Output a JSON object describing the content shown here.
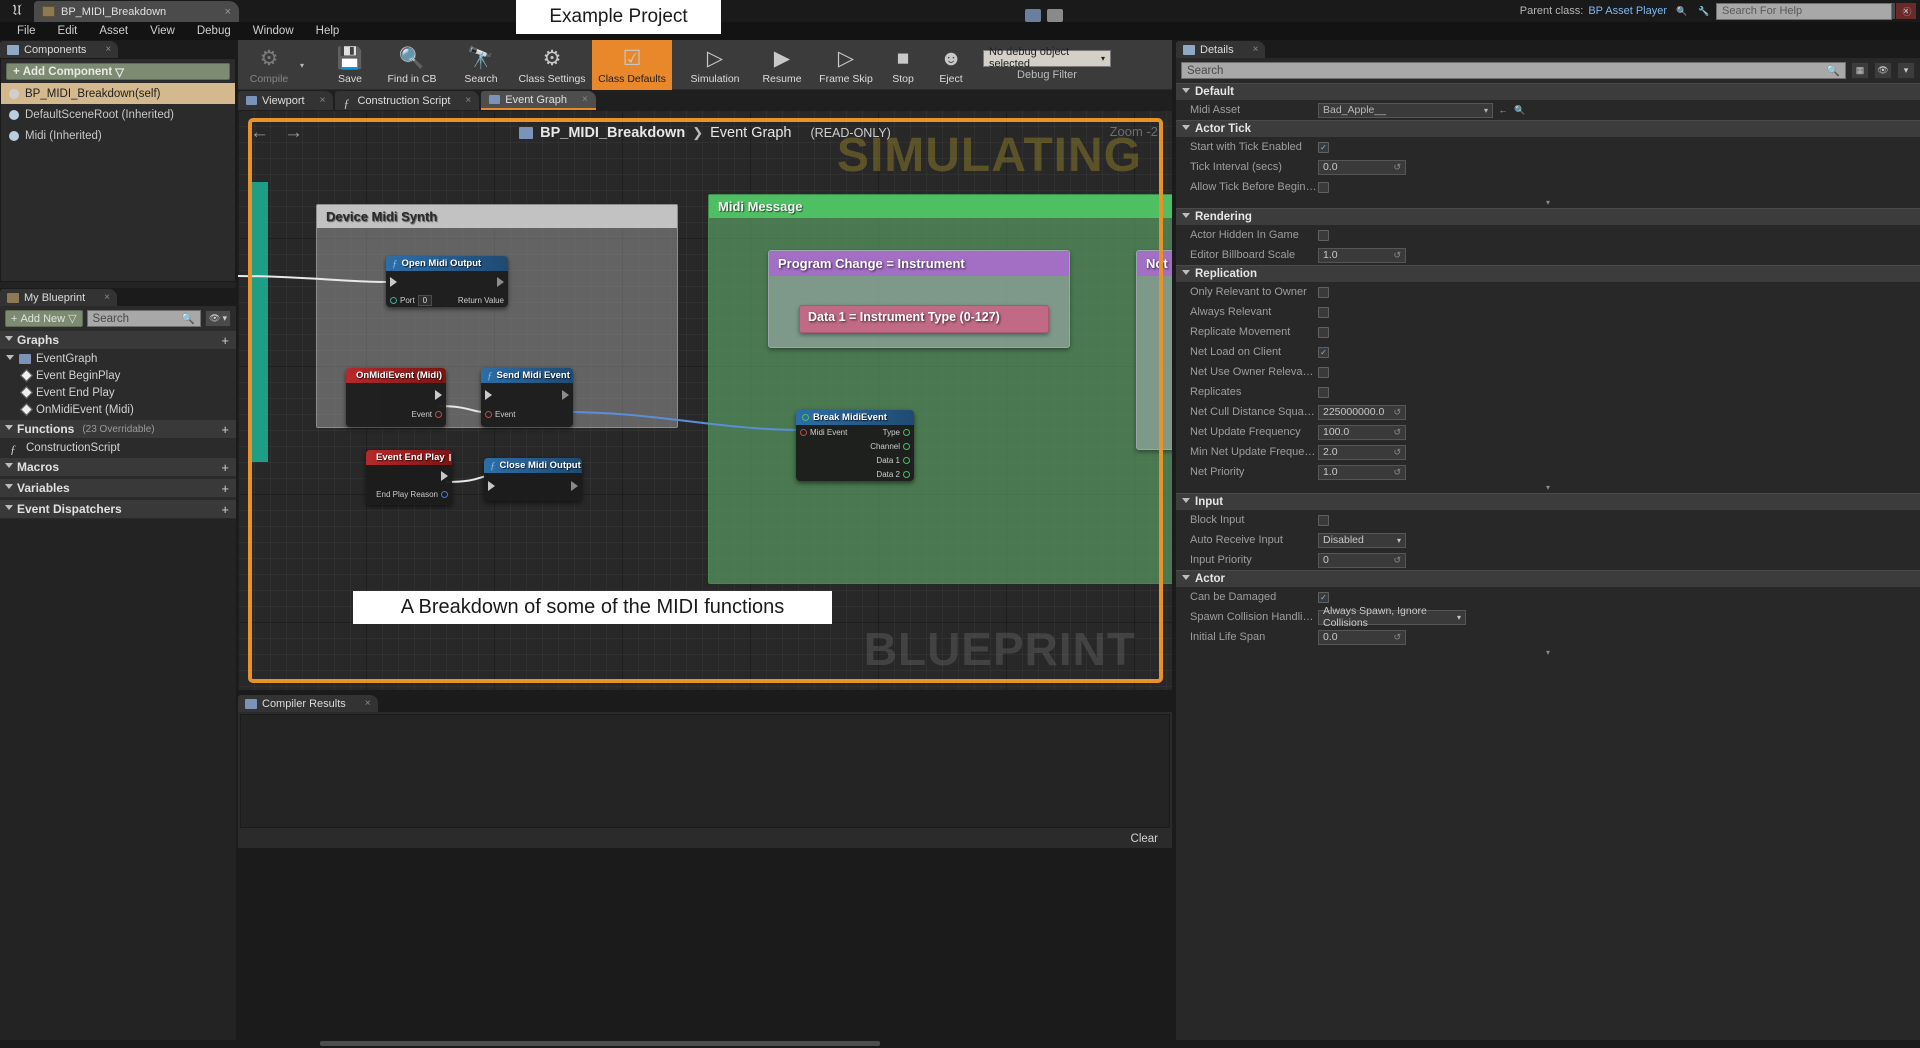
{
  "titlebar": {
    "tab_label": "BP_MIDI_Breakdown",
    "tab_close": "×",
    "min": "–",
    "max": "□",
    "close": "×"
  },
  "menubar": {
    "items": [
      "File",
      "Edit",
      "Asset",
      "View",
      "Debug",
      "Window",
      "Help"
    ]
  },
  "header_right": {
    "parent_class_label": "Parent class:",
    "parent_class_value": "BP Asset Player",
    "search_placeholder": "Search For Help"
  },
  "components_panel": {
    "tab_title": "Components",
    "tab_close": "×",
    "add_button": "Add Component",
    "add_caret": "▽",
    "items": [
      {
        "label": "BP_MIDI_Breakdown(self)",
        "selected": true
      },
      {
        "label": "DefaultSceneRoot (Inherited)",
        "selected": false
      },
      {
        "label": "Midi (Inherited)",
        "selected": false
      }
    ]
  },
  "myblueprint_panel": {
    "tab_title": "My Blueprint",
    "tab_close": "×",
    "add_new": "Add New",
    "add_new_caret": "▽",
    "search_placeholder": "Search",
    "sections": [
      {
        "title": "Graphs",
        "subtitle": "",
        "add": "+",
        "items": [
          {
            "label": "EventGraph",
            "kind": "graph",
            "indent": 0
          },
          {
            "label": "Event BeginPlay",
            "kind": "event",
            "indent": 1
          },
          {
            "label": "Event End Play",
            "kind": "event",
            "indent": 1
          },
          {
            "label": "OnMidiEvent (Midi)",
            "kind": "event",
            "indent": 1
          }
        ]
      },
      {
        "title": "Functions",
        "subtitle": "(23 Overridable)",
        "add": "+",
        "items": [
          {
            "label": "ConstructionScript",
            "kind": "function",
            "indent": 0
          }
        ]
      },
      {
        "title": "Macros",
        "subtitle": "",
        "add": "+",
        "items": []
      },
      {
        "title": "Variables",
        "subtitle": "",
        "add": "+",
        "items": []
      },
      {
        "title": "Event Dispatchers",
        "subtitle": "",
        "add": "+",
        "items": []
      }
    ]
  },
  "toolbar": {
    "buttons": [
      {
        "label": "Compile",
        "icon": "compile-icon",
        "glyph": "⚙",
        "state": "disabled",
        "caret": true
      },
      {
        "label": "Save",
        "icon": "save-icon",
        "glyph": "💾",
        "state": "normal"
      },
      {
        "label": "Find in CB",
        "icon": "find-in-content-browser-icon",
        "glyph": "🔍",
        "state": "normal"
      },
      {
        "label": "Search",
        "icon": "search-icon",
        "glyph": "🔭",
        "state": "normal"
      },
      {
        "label": "Class Settings",
        "icon": "class-settings-icon",
        "glyph": "⚙",
        "state": "normal"
      },
      {
        "label": "Class Defaults",
        "icon": "class-defaults-icon",
        "glyph": "☑",
        "state": "active"
      },
      {
        "label": "Simulation",
        "icon": "simulation-icon",
        "glyph": "▷",
        "state": "normal"
      },
      {
        "label": "Resume",
        "icon": "resume-icon",
        "glyph": "▶",
        "state": "normal"
      },
      {
        "label": "Frame Skip",
        "icon": "frame-skip-icon",
        "glyph": "▷",
        "state": "normal"
      },
      {
        "label": "Stop",
        "icon": "stop-icon",
        "glyph": "■",
        "state": "normal"
      },
      {
        "label": "Eject",
        "icon": "eject-icon",
        "glyph": "☻",
        "state": "normal"
      }
    ],
    "debug_object": "No debug object selected",
    "debug_caret": "▾",
    "debug_filter_label": "Debug Filter"
  },
  "graph_tabs": [
    {
      "label": "Viewport",
      "icon": "viewport-icon",
      "selected": false,
      "close": "×"
    },
    {
      "label": "Construction Script",
      "icon": "function-icon",
      "selected": false,
      "close": "×"
    },
    {
      "label": "Event Graph",
      "icon": "graph-icon",
      "selected": true,
      "close": "×"
    }
  ],
  "graph": {
    "back_arrow": "←",
    "forward_arrow": "→",
    "breadcrumb_root": "BP_MIDI_Breakdown",
    "breadcrumb_sep": "❯",
    "breadcrumb_current": "Event Graph",
    "read_only": "(READ-ONLY)",
    "zoom_label": "Zoom -2",
    "watermark_simulating": "SIMULATING",
    "watermark_blueprint": "BLUEPRINT",
    "comments": [
      {
        "title": "Device Midi Synth",
        "color": "#b9b9b9"
      },
      {
        "title": "Midi Message",
        "color": "#4fbf63"
      }
    ],
    "inner_boxes": [
      {
        "title": "Program Change = Instrument",
        "color": "#a36fc4"
      },
      {
        "title": "Data 1 = Instrument Type (0-127)",
        "color": "#c06a85"
      },
      {
        "title": "Not",
        "color": "#a36fc4"
      }
    ],
    "nodes": [
      {
        "title": "Open Midi Output",
        "icon": "function-icon",
        "header_color": "#2d5f8f",
        "pins": [
          {
            "label": "",
            "kind": "exec-in"
          },
          {
            "label": "Port",
            "kind": "data-in",
            "value": "0"
          },
          {
            "label": "Return Value",
            "kind": "data-out"
          }
        ]
      },
      {
        "title": "OnMidiEvent (Midi)",
        "icon": "event-icon",
        "header_color": "#a11e1e",
        "pins": [
          {
            "label": "Event",
            "kind": "exec-out"
          }
        ]
      },
      {
        "title": "Send Midi Event",
        "icon": "function-icon",
        "header_color": "#2d5f8f",
        "pins": [
          {
            "label": "Event",
            "kind": "data-in"
          }
        ]
      },
      {
        "title": "Event End Play",
        "icon": "event-icon",
        "header_color": "#a11e1e",
        "pins": [
          {
            "label": "End Play Reason",
            "kind": "data-out"
          }
        ]
      },
      {
        "title": "Close Midi Output",
        "icon": "function-icon",
        "header_color": "#2d5f8f",
        "pins": []
      },
      {
        "title": "Break MidiEvent",
        "icon": "break-icon",
        "header_color": "#2d5f8f",
        "pins": [
          {
            "label": "Midi Event",
            "kind": "data-in"
          },
          {
            "label": "Type",
            "kind": "data-out"
          },
          {
            "label": "Channel",
            "kind": "data-out"
          },
          {
            "label": "Data 1",
            "kind": "data-out"
          },
          {
            "label": "Data 2",
            "kind": "data-out"
          }
        ]
      }
    ]
  },
  "callouts": {
    "title_box": "Example Project",
    "description_box": "A Breakdown of some of the MIDI functions"
  },
  "compiler_results": {
    "tab_title": "Compiler Results",
    "tab_close": "×",
    "clear_button": "Clear",
    "log_lines": []
  },
  "details_panel": {
    "tab_title": "Details",
    "tab_close": "×",
    "search_placeholder": "Search",
    "categories": [
      {
        "name": "Default",
        "rows": [
          {
            "label": "Midi Asset",
            "type": "asset",
            "value": "Bad_Apple__"
          }
        ]
      },
      {
        "name": "Actor Tick",
        "rows": [
          {
            "label": "Start with Tick Enabled",
            "type": "checkbox",
            "value": true
          },
          {
            "label": "Tick Interval (secs)",
            "type": "number",
            "value": "0.0"
          },
          {
            "label": "Allow Tick Before Begin Play",
            "type": "checkbox",
            "value": false
          }
        ],
        "expander": "▾"
      },
      {
        "name": "Rendering",
        "rows": [
          {
            "label": "Actor Hidden In Game",
            "type": "checkbox",
            "value": false
          },
          {
            "label": "Editor Billboard Scale",
            "type": "number",
            "value": "1.0"
          }
        ]
      },
      {
        "name": "Replication",
        "rows": [
          {
            "label": "Only Relevant to Owner",
            "type": "checkbox",
            "value": false
          },
          {
            "label": "Always Relevant",
            "type": "checkbox",
            "value": false
          },
          {
            "label": "Replicate Movement",
            "type": "checkbox",
            "value": false
          },
          {
            "label": "Net Load on Client",
            "type": "checkbox",
            "value": true
          },
          {
            "label": "Net Use Owner Relevancy",
            "type": "checkbox",
            "value": false
          },
          {
            "label": "Replicates",
            "type": "checkbox",
            "value": false
          },
          {
            "label": "Net Cull Distance Squared",
            "type": "number",
            "value": "225000000.0"
          },
          {
            "label": "Net Update Frequency",
            "type": "number",
            "value": "100.0"
          },
          {
            "label": "Min Net Update Frequency",
            "type": "number",
            "value": "2.0"
          },
          {
            "label": "Net Priority",
            "type": "number",
            "value": "1.0"
          }
        ],
        "expander": "▾"
      },
      {
        "name": "Input",
        "rows": [
          {
            "label": "Block Input",
            "type": "checkbox",
            "value": false
          },
          {
            "label": "Auto Receive Input",
            "type": "select",
            "value": "Disabled"
          },
          {
            "label": "Input Priority",
            "type": "number",
            "value": "0"
          }
        ]
      },
      {
        "name": "Actor",
        "rows": [
          {
            "label": "Can be Damaged",
            "type": "checkbox",
            "value": true
          },
          {
            "label": "Spawn Collision Handling Method",
            "type": "select",
            "value": "Always Spawn, Ignore Collisions"
          },
          {
            "label": "Initial Life Span",
            "type": "number",
            "value": "0.0"
          }
        ],
        "expander": "▾"
      }
    ]
  }
}
